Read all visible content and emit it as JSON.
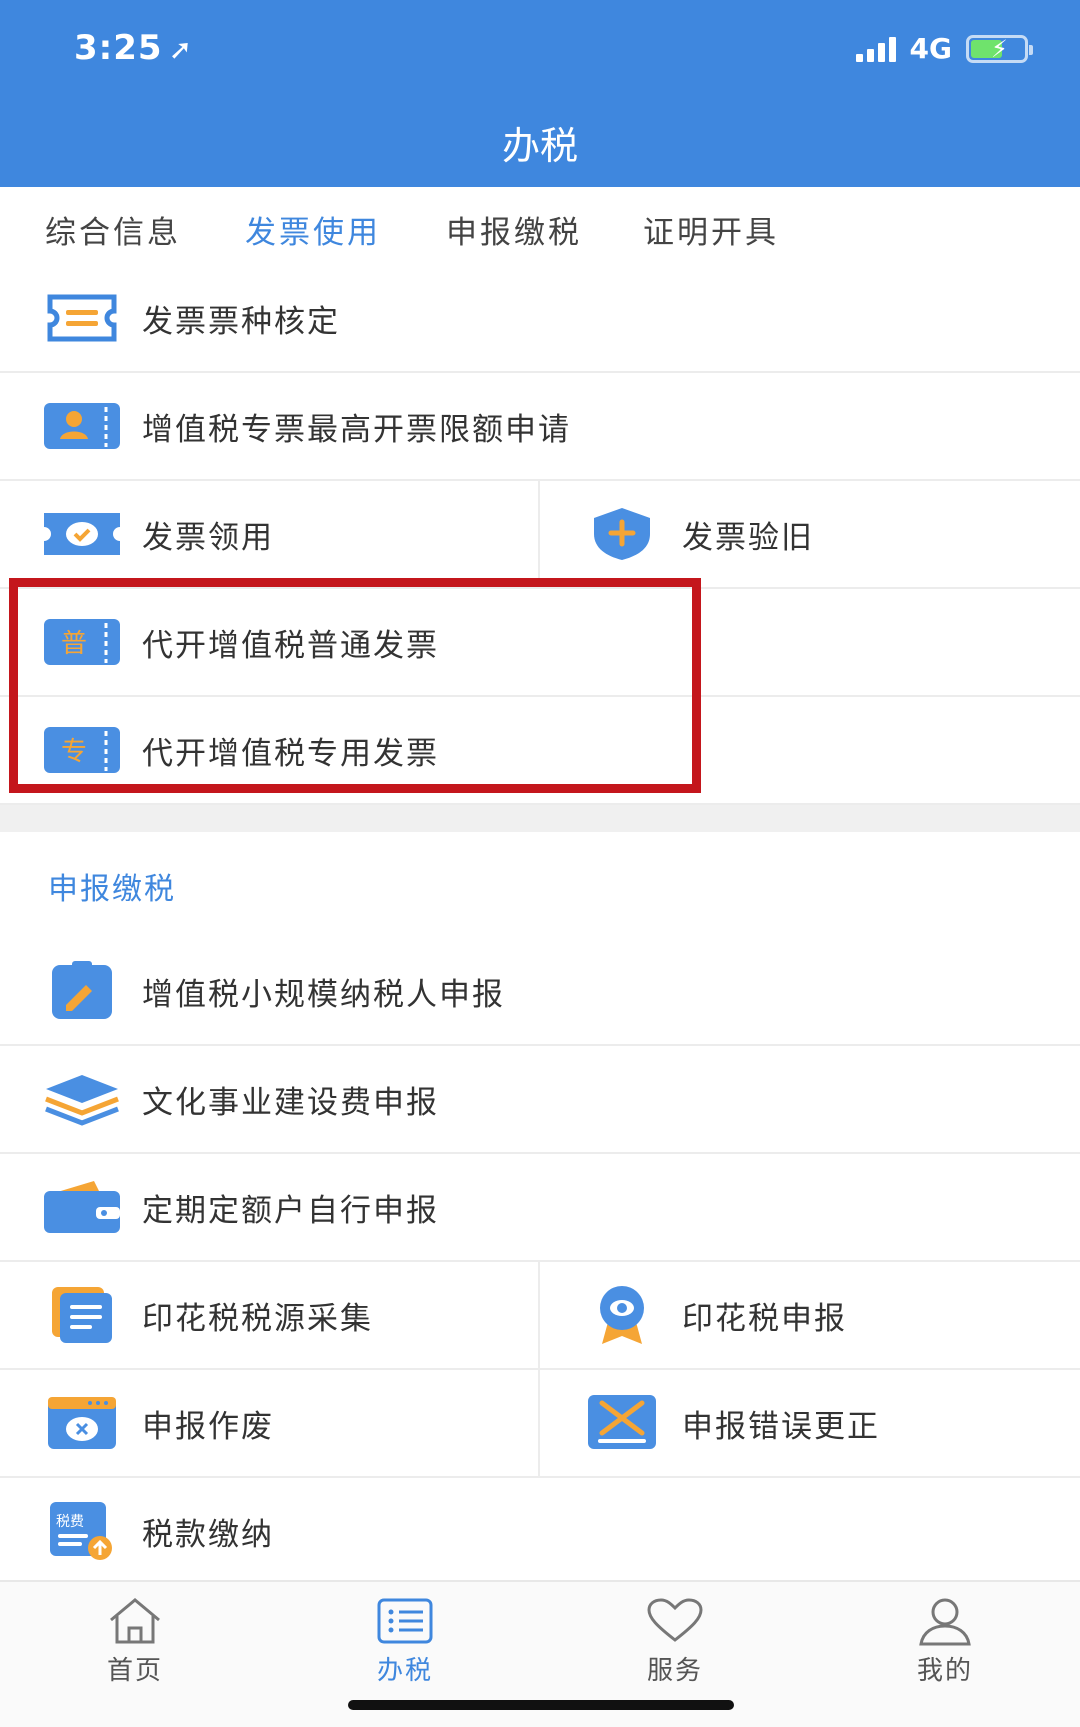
{
  "status_bar": {
    "time": "3:25",
    "network": "4G"
  },
  "header": {
    "title": "办税"
  },
  "tabs": [
    {
      "label": "综合信息",
      "active": false
    },
    {
      "label": "发票使用",
      "active": true
    },
    {
      "label": "申报缴税",
      "active": false
    },
    {
      "label": "证明开具",
      "active": false
    }
  ],
  "invoice_items": {
    "type_check": {
      "label": "发票票种核定",
      "icon": "ticket-icon"
    },
    "vat_limit": {
      "label": "增值税专票最高开票限额申请",
      "icon": "person-card-icon"
    },
    "receive": {
      "label": "发票领用",
      "icon": "check-ticket-icon"
    },
    "verify_old": {
      "label": "发票验旧",
      "icon": "shield-plus-icon"
    },
    "proxy_general": {
      "label": "代开增值税普通发票",
      "icon": "general-invoice-icon",
      "badge": "普"
    },
    "proxy_special": {
      "label": "代开增值税专用发票",
      "icon": "special-invoice-icon",
      "badge": "专"
    }
  },
  "declare_section": {
    "title": "申报缴税",
    "items": {
      "small_scale": {
        "label": "增值税小规模纳税人申报",
        "icon": "clipboard-pen-icon"
      },
      "culture_fee": {
        "label": "文化事业建设费申报",
        "icon": "layers-icon"
      },
      "fixed_quota": {
        "label": "定期定额户自行申报",
        "icon": "wallet-icon"
      },
      "stamp_source": {
        "label": "印花税税源采集",
        "icon": "document-stack-icon"
      },
      "stamp_declare": {
        "label": "印花税申报",
        "icon": "award-badge-icon"
      },
      "void": {
        "label": "申报作废",
        "icon": "window-x-icon"
      },
      "correct": {
        "label": "申报错误更正",
        "icon": "cross-board-icon"
      },
      "payment": {
        "label": "税款缴纳",
        "icon": "tax-upload-icon",
        "badge": "税费"
      }
    }
  },
  "tabbar": [
    {
      "label": "首页",
      "icon": "home-icon",
      "active": false
    },
    {
      "label": "办税",
      "icon": "list-icon",
      "active": true
    },
    {
      "label": "服务",
      "icon": "heart-icon",
      "active": false
    },
    {
      "label": "我的",
      "icon": "user-icon",
      "active": false
    }
  ],
  "colors": {
    "primary": "#3f87de",
    "highlight": "#c4161c",
    "icon_orange": "#f5a535"
  }
}
